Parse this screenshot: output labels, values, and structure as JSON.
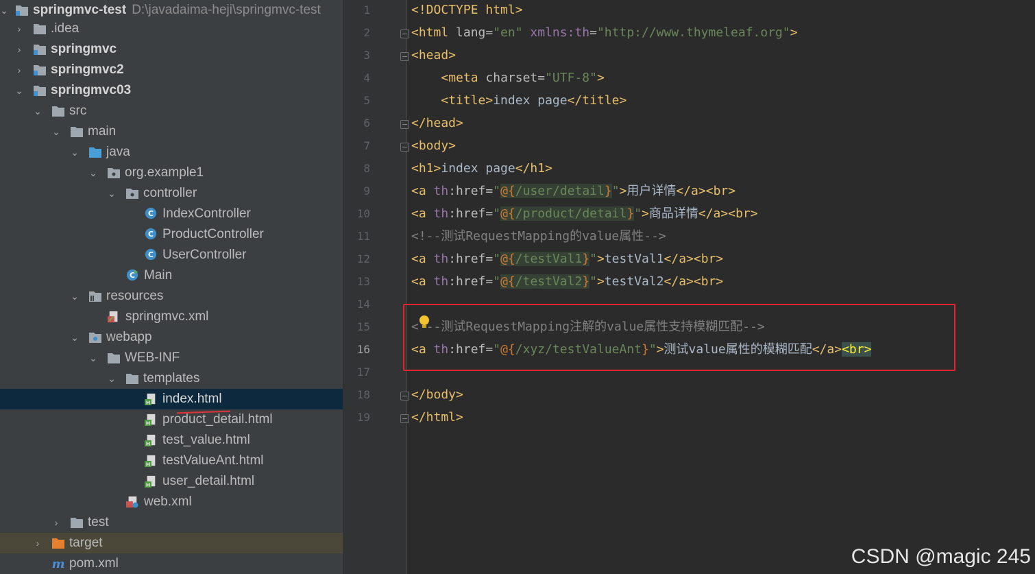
{
  "project": {
    "root_name": "springmvc-test",
    "root_path": "D:\\javadaima-heji\\springmvc-test",
    "items": [
      {
        "label": "springmvc-test"
      },
      {
        "label": ".idea"
      },
      {
        "label": "springmvc"
      },
      {
        "label": "springmvc2"
      },
      {
        "label": "springmvc03"
      },
      {
        "label": "src"
      },
      {
        "label": "main"
      },
      {
        "label": "java"
      },
      {
        "label": "org.example1"
      },
      {
        "label": "controller"
      },
      {
        "label": "IndexController"
      },
      {
        "label": "ProductController"
      },
      {
        "label": "UserController"
      },
      {
        "label": "Main"
      },
      {
        "label": "resources"
      },
      {
        "label": "springmvc.xml"
      },
      {
        "label": "webapp"
      },
      {
        "label": "WEB-INF"
      },
      {
        "label": "templates"
      },
      {
        "label": "index.html"
      },
      {
        "label": "product_detail.html"
      },
      {
        "label": "test_value.html"
      },
      {
        "label": "testValueAnt.html"
      },
      {
        "label": "user_detail.html"
      },
      {
        "label": "web.xml"
      },
      {
        "label": "test"
      },
      {
        "label": "target"
      },
      {
        "label": "pom.xml"
      }
    ]
  },
  "editor": {
    "line_numbers": [
      "1",
      "2",
      "3",
      "4",
      "5",
      "6",
      "7",
      "8",
      "9",
      "10",
      "11",
      "12",
      "13",
      "14",
      "15",
      "16",
      "17",
      "18",
      "19"
    ],
    "current_line": "16",
    "code": {
      "l1": "<!DOCTYPE html>",
      "l2_open": "<html ",
      "l2_attr1": "lang=",
      "l2_val1": "\"en\"",
      "l2_ns": "xmlns:th",
      "l2_eq": "=",
      "l2_val2": "\"http://www.thymeleaf.org\"",
      "l2_close": ">",
      "l3": "<head>",
      "l4_tag": "<meta ",
      "l4_attr": "charset=",
      "l4_val": "\"UTF-8\"",
      "l4_close": ">",
      "l5_open": "<title>",
      "l5_text": "index page",
      "l5_close": "</title>",
      "l6": "</head>",
      "l7": "<body>",
      "l8_open": "<h1>",
      "l8_text": "index page",
      "l8_close": "</h1>",
      "a_open": "<a ",
      "th": "th",
      "href_eq": ":href=",
      "quote": "\"",
      "at": "@",
      "brace_open": "{",
      "brace_close": "}",
      "slash": "/",
      "tag_gt": ">",
      "a_close": "</a>",
      "br": "<br>",
      "l9_p1": "user",
      "l9_p2": "detail",
      "l9_text": "用户详情",
      "l10_p1": "product",
      "l10_p2": "detail",
      "l10_text": "商品详情",
      "l11": "<!--测试RequestMapping的value属性-->",
      "l12_p": "testVal1",
      "l12_text": "testVal1",
      "l13_p": "testVal2",
      "l13_text": "testVal2",
      "l15_lt": "<",
      "l15_rest": "--测试RequestMapping注解的value属性支持模糊匹配-->",
      "l16_p1": "xyz",
      "l16_p2": "testValueAnt",
      "l16_text": "测试value属性的模糊匹配",
      "l18": "</body>",
      "l19": "</html>"
    }
  },
  "watermark": "CSDN @magic 245",
  "colors": {
    "tree_bg": "#3c3f41",
    "editor_bg": "#2b2b2b",
    "selected_row": "#0d293e",
    "highlight_box": "#e0262b"
  }
}
